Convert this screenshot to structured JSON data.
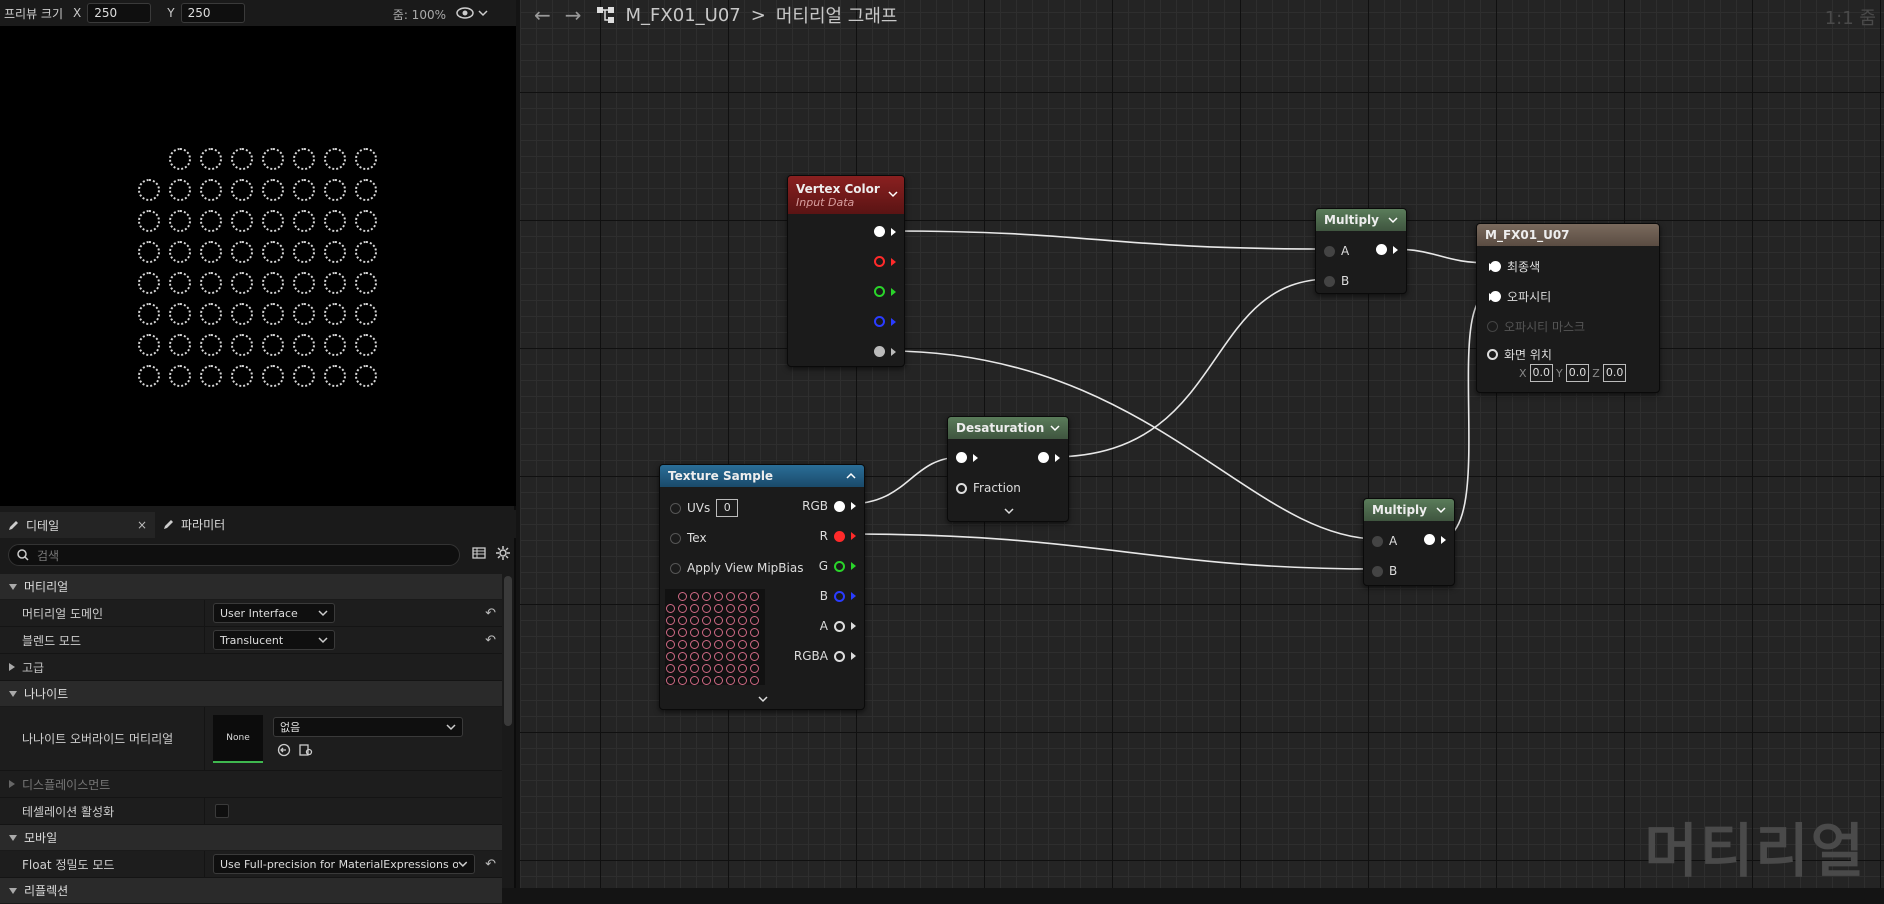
{
  "preview": {
    "size_label": "프리뷰 크기",
    "x_label": "X",
    "x_value": "250",
    "y_label": "Y",
    "y_value": "250",
    "zoom": "줌: 100%"
  },
  "tabs": [
    {
      "label": "디테일",
      "close": "×"
    },
    {
      "label": "파라미터"
    }
  ],
  "search": {
    "placeholder": "검색"
  },
  "details": {
    "material_cat": "머티리얼",
    "domain_label": "머티리얼 도메인",
    "domain_value": "User Interface",
    "blend_label": "블렌드 모드",
    "blend_value": "Translucent",
    "advanced_cat": "고급",
    "nanite_cat": "나나이트",
    "nanite_override_label": "나나이트 오버라이드 머티리얼",
    "nanite_none_thumb": "None",
    "nanite_override_value": "없음",
    "displacement_cat": "디스플레이스먼트",
    "tessellation_label": "테셀레이션 활성화",
    "mobile_cat": "모바일",
    "float_label": "Float 정밀도 모드",
    "float_value": "Use Full-precision for MaterialExpressions on",
    "reflection_cat": "리플렉션"
  },
  "graph": {
    "breadcrumb_asset": "M_FX01_U07",
    "breadcrumb_sep": ">",
    "breadcrumb_page": "머티리얼 그래프",
    "scale": "1:1 줌",
    "watermark": "머티리얼"
  },
  "nodes": {
    "vertex_color": {
      "title": "Vertex Color",
      "subtitle": "Input Data"
    },
    "texture_sample": {
      "title": "Texture Sample",
      "uvs": "UVs",
      "uvs_value": "0",
      "tex": "Tex",
      "mip": "Apply View MipBias",
      "rgb": "RGB",
      "r": "R",
      "g": "G",
      "b": "B",
      "a": "A",
      "rgba": "RGBA"
    },
    "desaturation": {
      "title": "Desaturation",
      "fraction": "Fraction"
    },
    "multiply_top": {
      "title": "Multiply",
      "a": "A",
      "b": "B"
    },
    "multiply_bottom": {
      "title": "Multiply",
      "a": "A",
      "b": "B"
    },
    "output": {
      "title": "M_FX01_U07",
      "final_color": "최종색",
      "opacity": "오파시티",
      "opacity_mask": "오파시티 마스크",
      "screen_pos": "화면 위치",
      "x_label": "X",
      "x_value": "0.0",
      "y_label": "Y",
      "y_value": "0.0",
      "z_label": "Z",
      "z_value": "0.0"
    }
  },
  "colors": {
    "vertex_color_header": "#7a1d1d",
    "texture_header": "#1f5e86",
    "math_header": "#4f6b4f",
    "output_header": "#6b5a4d",
    "wire": "#e8e8e8",
    "pin_red": "#ff2a2a",
    "pin_green": "#2ad42a",
    "pin_blue": "#2a3cff"
  }
}
